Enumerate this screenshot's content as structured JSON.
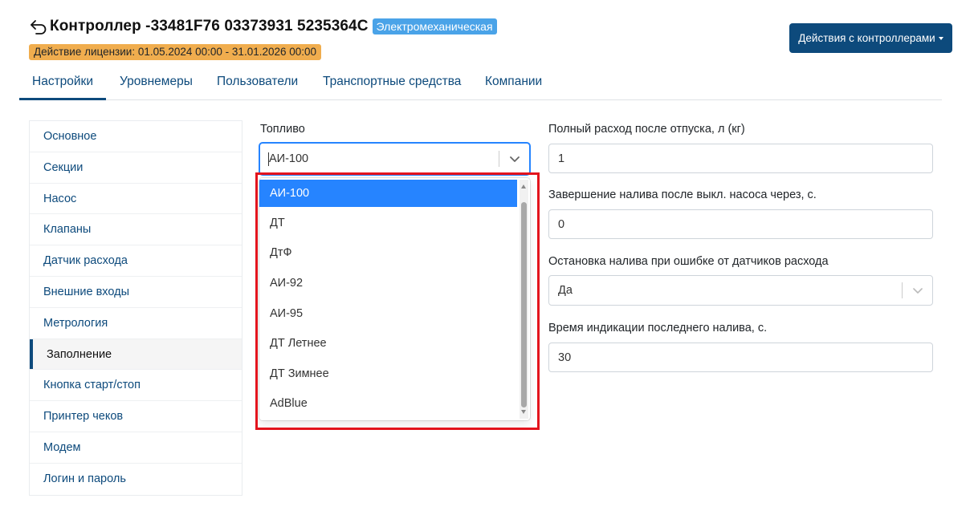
{
  "header": {
    "title": "Контроллер -33481F76 03373931 5235364C",
    "type_badge": "Электромеханическая",
    "license": "Действие лицензии: 01.05.2024 00:00 - 31.01.2026 00:00",
    "actions_button": "Действия с контроллерами"
  },
  "tabs": [
    {
      "label": "Настройки",
      "active": true
    },
    {
      "label": "Уровнемеры"
    },
    {
      "label": "Пользователи"
    },
    {
      "label": "Транспортные средства"
    },
    {
      "label": "Компании"
    }
  ],
  "sidebar": {
    "items": [
      {
        "label": "Основное"
      },
      {
        "label": "Секции"
      },
      {
        "label": "Насос"
      },
      {
        "label": "Клапаны"
      },
      {
        "label": "Датчик расхода"
      },
      {
        "label": "Внешние входы"
      },
      {
        "label": "Метрология"
      },
      {
        "label": "Заполнение",
        "active": true
      },
      {
        "label": "Кнопка старт/стоп"
      },
      {
        "label": "Принтер чеков"
      },
      {
        "label": "Модем"
      },
      {
        "label": "Логин и пароль"
      }
    ]
  },
  "fuel": {
    "label": "Топливо",
    "value": "АИ-100",
    "options": [
      "АИ-100",
      "ДТ",
      "ДтФ",
      "АИ-92",
      "АИ-95",
      "ДТ Летнее",
      "ДТ Зимнее",
      "AdBlue"
    ],
    "selected_index": 0
  },
  "fields": {
    "full_consumption": {
      "label": "Полный расход после отпуска, л (кг)",
      "value": "1"
    },
    "finish_filling": {
      "label": "Завершение налива после выкл. насоса через, с.",
      "value": "0"
    },
    "stop_on_error": {
      "label": "Остановка налива при ошибке от датчиков расхода",
      "value": "Да"
    },
    "indication_time": {
      "label": "Время индикации последнего налива, с.",
      "value": "30"
    }
  },
  "colors": {
    "primary": "#0d4a7c",
    "badge_blue": "#4aa3e8",
    "badge_orange": "#f0ad4e",
    "option_selected": "#2684ff",
    "highlight_red": "#e3141d"
  },
  "icons": {
    "back": "back-arrow-icon",
    "chevron": "chevron-down-icon"
  }
}
